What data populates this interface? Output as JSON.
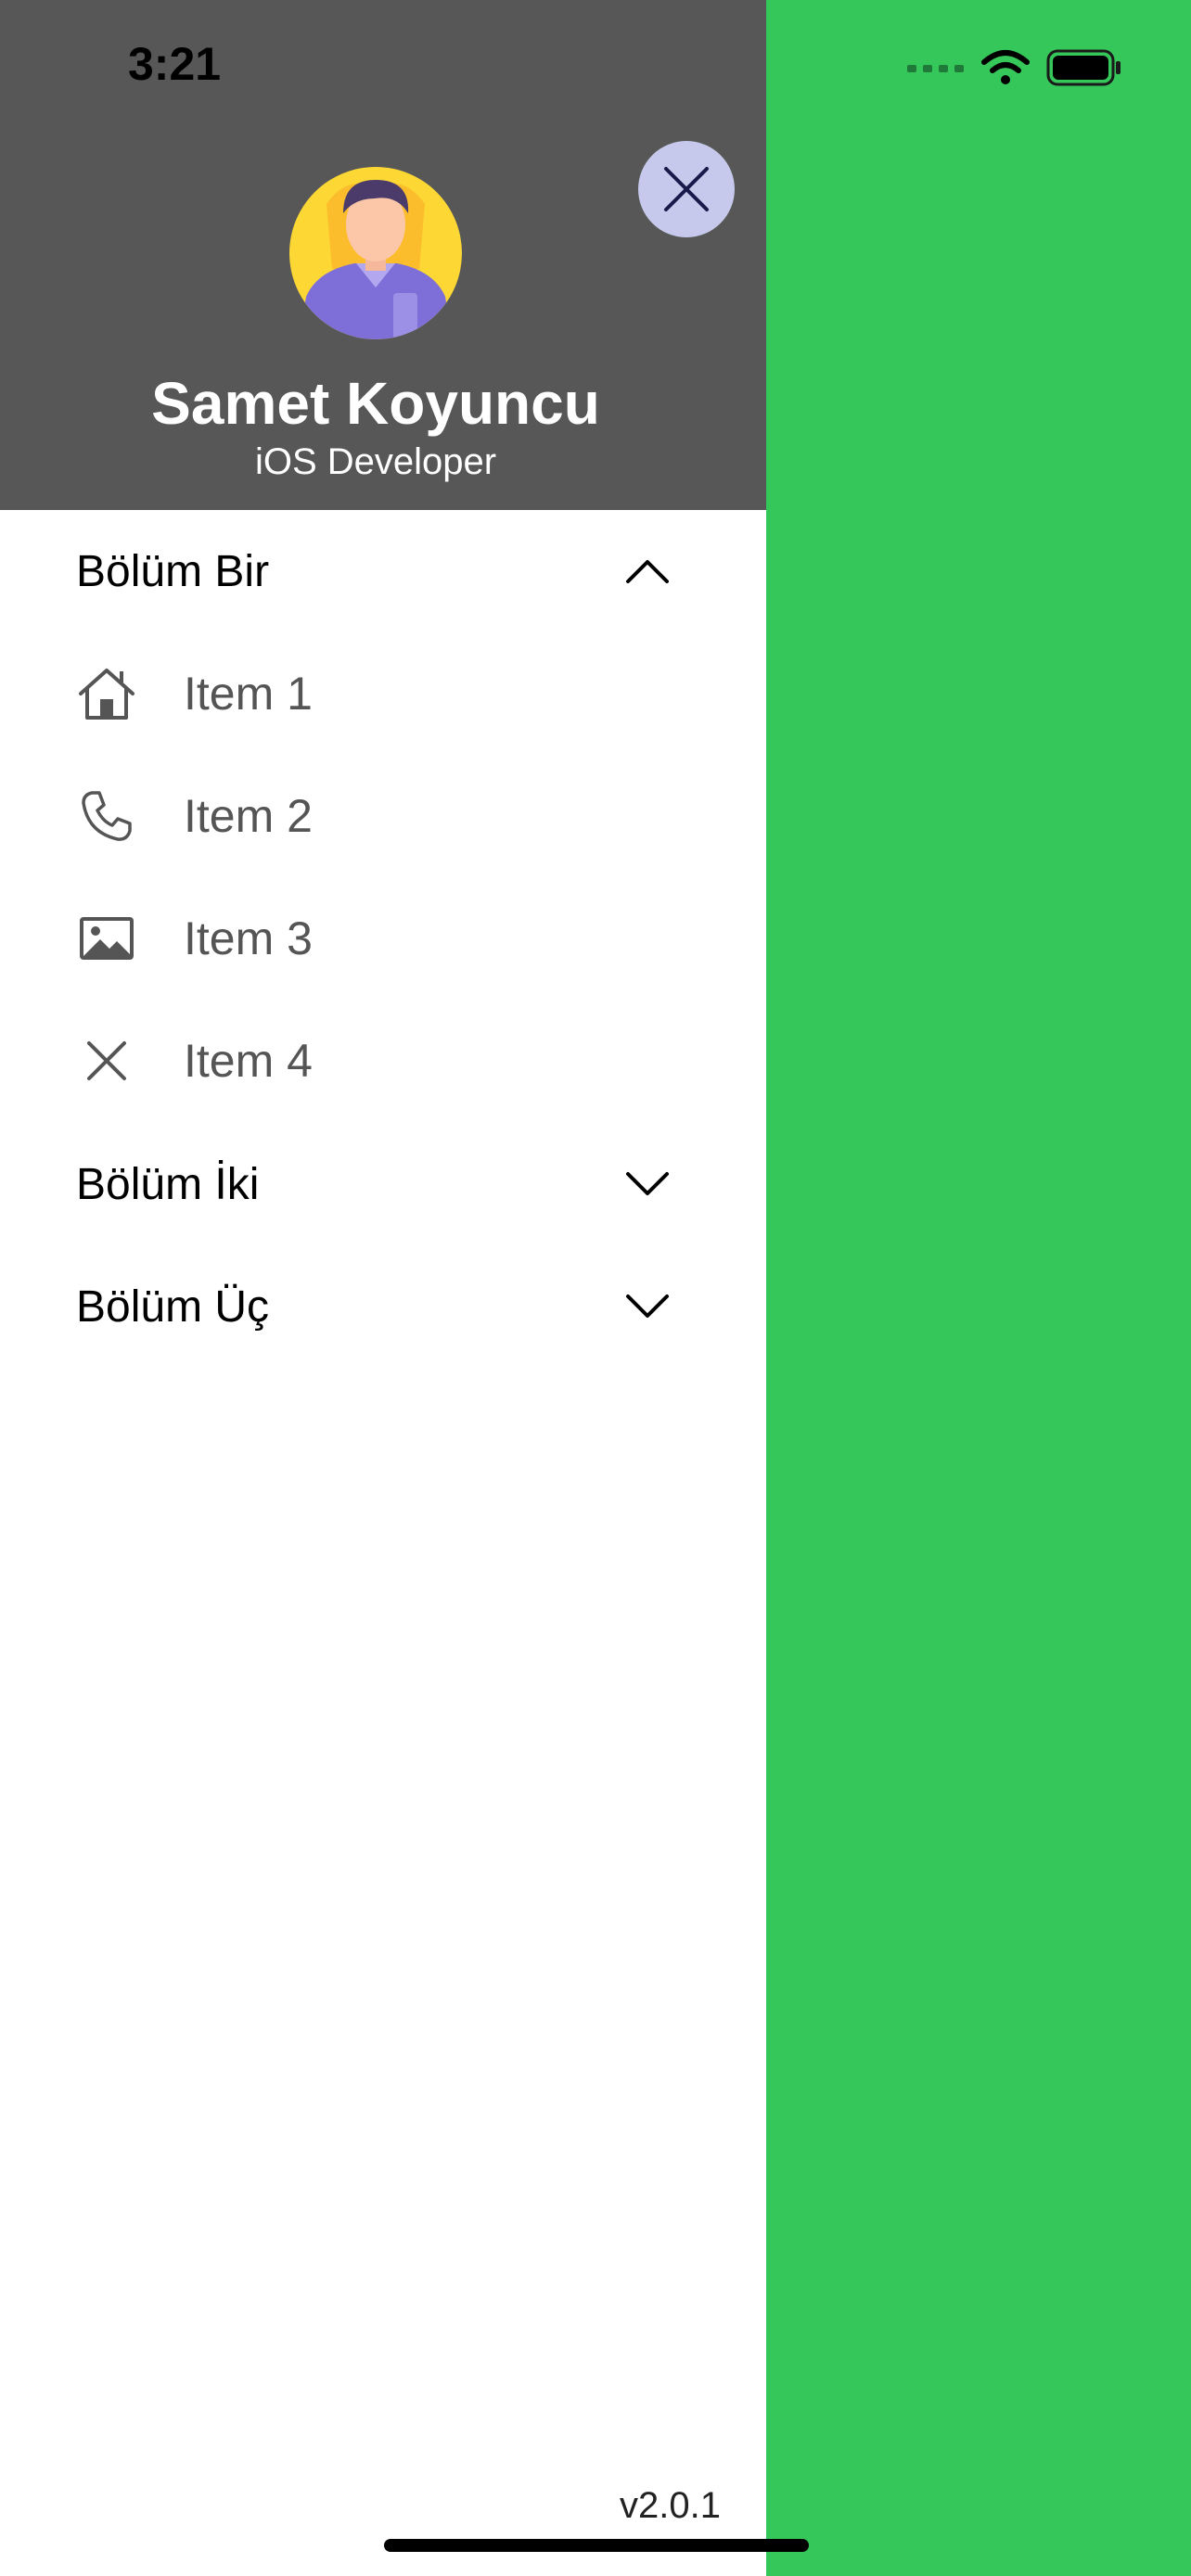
{
  "status_bar": {
    "time": "3:21"
  },
  "profile": {
    "name": "Samet Koyuncu",
    "role": "iOS Developer"
  },
  "sections": [
    {
      "title": "Bölüm Bir",
      "expanded": true,
      "items": [
        {
          "label": "Item 1",
          "icon": "house-icon"
        },
        {
          "label": "Item 2",
          "icon": "phone-icon"
        },
        {
          "label": "Item 3",
          "icon": "photo-icon"
        },
        {
          "label": "Item 4",
          "icon": "xmark-icon"
        }
      ]
    },
    {
      "title": "Bölüm İki",
      "expanded": false
    },
    {
      "title": "Bölüm Üç",
      "expanded": false
    }
  ],
  "footer": {
    "version": "v2.0.1"
  },
  "colors": {
    "background": "#35c759",
    "header": "#575757",
    "drawer": "#ffffff",
    "close_button": "#c6c9ec",
    "close_icon": "#1a1a4a",
    "item_text": "#555555"
  }
}
